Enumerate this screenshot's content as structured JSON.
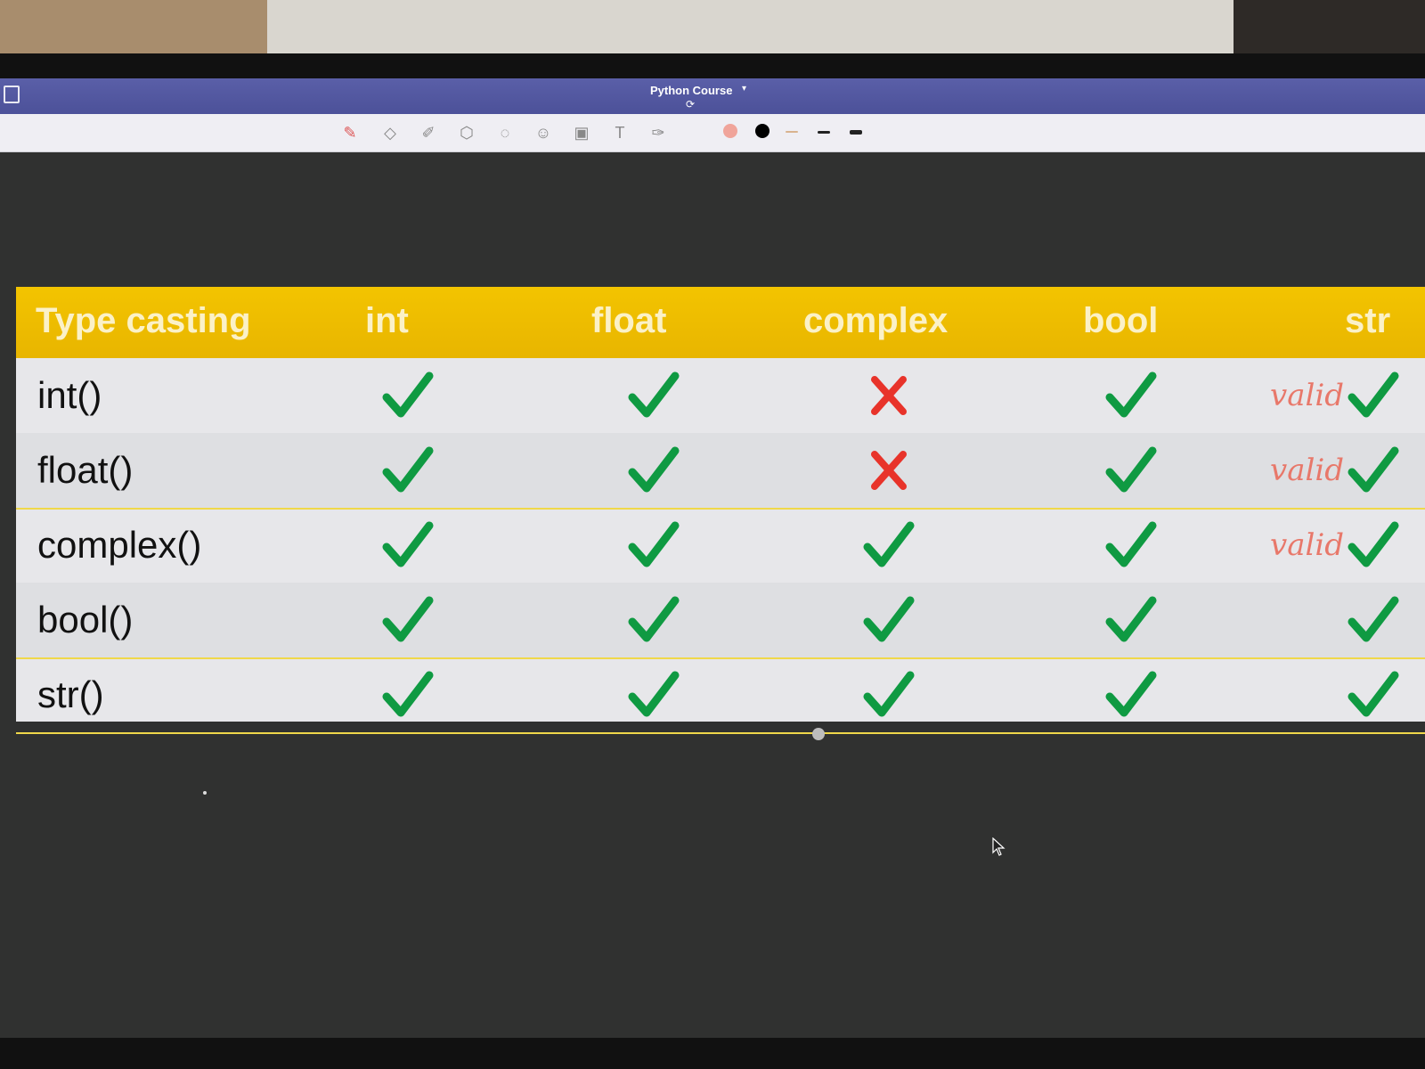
{
  "window": {
    "title": "Python Course"
  },
  "toolbar": {
    "tools": [
      "pencil-icon",
      "eraser-icon",
      "highlighter-icon",
      "shapes-icon",
      "lasso-icon",
      "sticker-icon",
      "image-icon",
      "text-box-icon",
      "magic-pen-icon"
    ],
    "colors": [
      "#f0a49a",
      "#000000",
      "#f2c9a7"
    ]
  },
  "table": {
    "header": [
      "Type casting",
      "int",
      "float",
      "complex",
      "bool",
      "str"
    ],
    "rows": [
      {
        "label": "int()",
        "cells": [
          "check",
          "check",
          "cross",
          "check",
          "check"
        ],
        "note": "valid"
      },
      {
        "label": "float()",
        "cells": [
          "check",
          "check",
          "cross",
          "check",
          "check"
        ],
        "note": "valid"
      },
      {
        "label": "complex()",
        "cells": [
          "check",
          "check",
          "check",
          "check",
          "check"
        ],
        "note": "valid"
      },
      {
        "label": "bool()",
        "cells": [
          "check",
          "check",
          "check",
          "check",
          "check"
        ],
        "note": ""
      },
      {
        "label": "str()",
        "cells": [
          "check",
          "check",
          "check",
          "check",
          "check"
        ],
        "note": ""
      }
    ],
    "colors": {
      "header": "#f3c400",
      "check": "#0f9a42",
      "cross": "#e8332a",
      "note": "#e8786a"
    }
  }
}
